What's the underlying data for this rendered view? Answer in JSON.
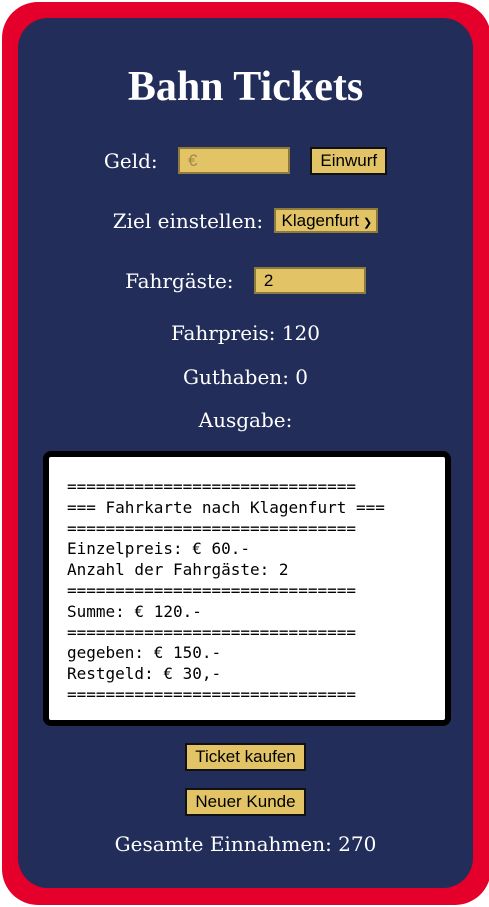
{
  "title": "Bahn Tickets",
  "money": {
    "label": "Geld:",
    "placeholder": "€",
    "value": "",
    "insert_label": "Einwurf"
  },
  "destination": {
    "label": "Ziel einstellen:",
    "selected": "Klagenfurt"
  },
  "passengers": {
    "label": "Fahrgäste:",
    "value": "2"
  },
  "fare": "Fahrpreis: 120",
  "balance": "Guthaben: 0",
  "output_label": "Ausgabe:",
  "ticket_lines": [
    "==============================",
    "=== Fahrkarte nach Klagenfurt ===",
    "==============================",
    "Einzelpreis: € 60.-",
    "Anzahl der Fahrgäste: 2",
    "==============================",
    "Summe: € 120.-",
    "==============================",
    "gegeben: € 150.-",
    "Restgeld: € 30,-",
    "=============================="
  ],
  "buy_label": "Ticket kaufen",
  "new_customer_label": "Neuer Kunde",
  "total_revenue": "Gesamte Einnahmen: 270",
  "colors": {
    "frame": "#e4002b",
    "panel": "#222d5a",
    "control": "#e2c466"
  }
}
